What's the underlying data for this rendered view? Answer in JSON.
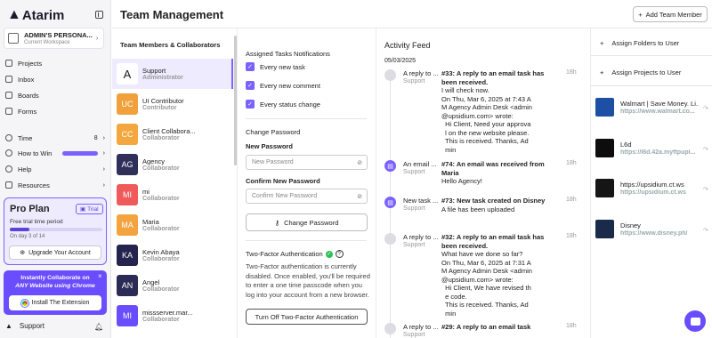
{
  "sidebar": {
    "logo": "Atarim",
    "workspace": {
      "name": "ADMIN'S PERSONA...",
      "sub": "Current Workspace"
    },
    "nav": [
      {
        "label": "Projects"
      },
      {
        "label": "Inbox"
      },
      {
        "label": "Boards"
      },
      {
        "label": "Forms"
      }
    ],
    "nav2": [
      {
        "label": "Time",
        "badge": "8"
      },
      {
        "label": "How to Win"
      },
      {
        "label": "Help"
      },
      {
        "label": "Resources"
      }
    ],
    "pro": {
      "title": "Pro Plan",
      "trial": "Trial",
      "sub": "Free trial time period",
      "progress": 0.21,
      "day": "On day 3 of 14",
      "upgrade": "Upgrade Your Account"
    },
    "promo": {
      "line1": "Instantly Collaborate on",
      "line2": "ANY Website using Chrome",
      "button": "Install The Extension"
    },
    "support": "Support"
  },
  "header": {
    "title": "Team Management",
    "add_member": "Add Team Member"
  },
  "members": {
    "title": "Team Members & Collaborators",
    "list": [
      {
        "initials": "A",
        "name": "Support",
        "role": "Administrator",
        "color": "#ffffff",
        "active": true
      },
      {
        "initials": "UC",
        "name": "UI Contributor",
        "role": "Contributor",
        "color": "#f0a13c"
      },
      {
        "initials": "CC",
        "name": "Client Collabora...",
        "role": "Collaborator",
        "color": "#f3a73e"
      },
      {
        "initials": "AG",
        "name": "Agency",
        "role": "Collaborator",
        "color": "#2f2f5a"
      },
      {
        "initials": "MI",
        "name": "mi",
        "role": "Collaborator",
        "color": "#ef5a5a"
      },
      {
        "initials": "MA",
        "name": "Maria",
        "role": "Collaborator",
        "color": "#f4a43f"
      },
      {
        "initials": "KA",
        "name": "Kevin Abaya",
        "role": "Collaborator",
        "color": "#24244f"
      },
      {
        "initials": "AN",
        "name": "Angel",
        "role": "Collaborator",
        "color": "#2b2b55"
      },
      {
        "initials": "MI",
        "name": "missserver.mar...",
        "role": "Collaborator",
        "color": "#6a4dff"
      }
    ]
  },
  "settings": {
    "assigned_title": "Assigned Tasks Notifications",
    "checks": [
      "Every new task",
      "Every new comment",
      "Every status change"
    ],
    "change_pw_title": "Change Password",
    "new_pw_label": "New Password",
    "new_pw_placeholder": "New Password",
    "confirm_label": "Confirm New Password",
    "confirm_placeholder": "Confirm New Password",
    "change_btn": "Change Password",
    "tfa_title": "Two-Factor Authentication",
    "tfa_desc": "Two-Factor authentication is currently disabled. Once enabled, you'll be required to enter a one time passcode when you log into your account from a new browser.",
    "tfa_btn": "Turn Off Two-Factor Authentication"
  },
  "feed": {
    "title": "Activity Feed",
    "date": "05/03/2025",
    "items": [
      {
        "who": "A reply to ...",
        "sub": "Support",
        "time": "18h",
        "icon": "grey",
        "head": "#33: A reply to an email task has been received.",
        "lines": [
          "I will check now.",
          "On Thu, Mar 6, 2025 at 7:43 A",
          "M Agency Admin Desk <admin",
          "@upsidium.com> wrote:",
          "  Hi Client, Need your approva",
          "  l on the new website please.",
          "  This is received. Thanks, Ad",
          "  min"
        ]
      },
      {
        "who": "An email ...",
        "sub": "Support",
        "time": "18h",
        "icon": "purple",
        "head": "#74: An email was received from Maria",
        "lines": [
          "Hello Agency!"
        ]
      },
      {
        "who": "New task ...",
        "sub": "Support",
        "time": "18h",
        "icon": "purple",
        "head": "#73: New task created on Disney",
        "lines": [
          "A file has been uploaded"
        ]
      },
      {
        "who": "A reply to ...",
        "sub": "Support",
        "time": "18h",
        "icon": "grey",
        "head": "#32: A reply to an email task has been received.",
        "lines": [
          "What have we done so far?",
          "On Thu, Mar 6, 2025 at 7:31 A",
          "M Agency Admin Desk <admin",
          "@upsidium.com> wrote:",
          "  Hi Client, We have revised th",
          "  e code.",
          "  This is received. Thanks, Ad",
          "  min"
        ]
      },
      {
        "who": "A reply to ...",
        "sub": "Support",
        "time": "18h",
        "icon": "grey",
        "head": "#29: A reply to an email task",
        "lines": []
      }
    ]
  },
  "right": {
    "assign_folders": "Assign Folders to User",
    "assign_projects": "Assign Projects to User",
    "links": [
      {
        "title": "Walmart | Save Money. Li...",
        "url": "https://www.walmart.co..."
      },
      {
        "title": "L6d",
        "url": "https://l6d.42a.myftpupl..."
      },
      {
        "title": "https://upsidium.ct.ws",
        "url": "https://upsidium.ct.ws"
      },
      {
        "title": "Disney",
        "url": "https://www.disney.ph/"
      }
    ]
  },
  "colors": {
    "accent": "#7b61ff",
    "promo": "#6a4dff"
  }
}
